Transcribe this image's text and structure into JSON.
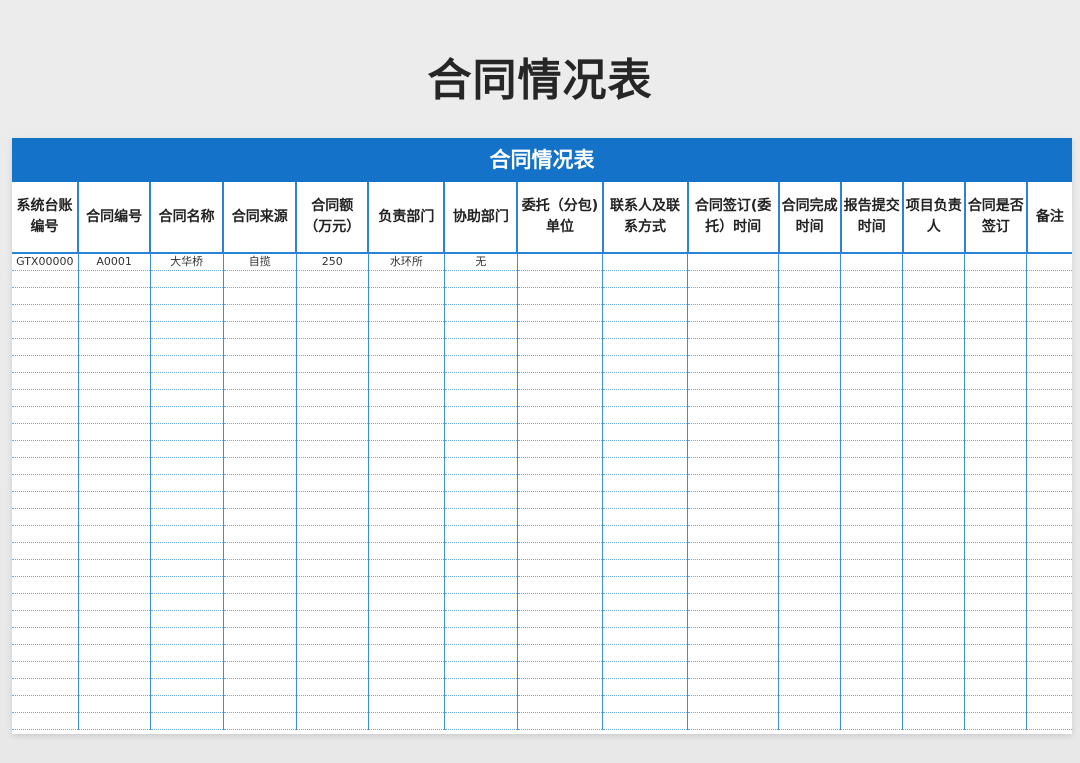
{
  "page_title": "合同情况表",
  "sheet": {
    "banner_title": "合同情况表",
    "columns": [
      "系统台账编号",
      "合同编号",
      "合同名称",
      "合同来源",
      "合同额（万元）",
      "负责部门",
      "协助部门",
      "委托（分包)单位",
      "联系人及联系方式",
      "合同签订(委托）时间",
      "合同完成时间",
      "报告提交时间",
      "项目负责人",
      "合同是否签订",
      "备注"
    ],
    "rows": [
      [
        "GTX00000",
        "A0001",
        "大华桥",
        "自揽",
        "250",
        "水环所",
        "无",
        "",
        "",
        "",
        "",
        "",
        "",
        "",
        ""
      ]
    ],
    "empty_row_count": 27
  }
}
